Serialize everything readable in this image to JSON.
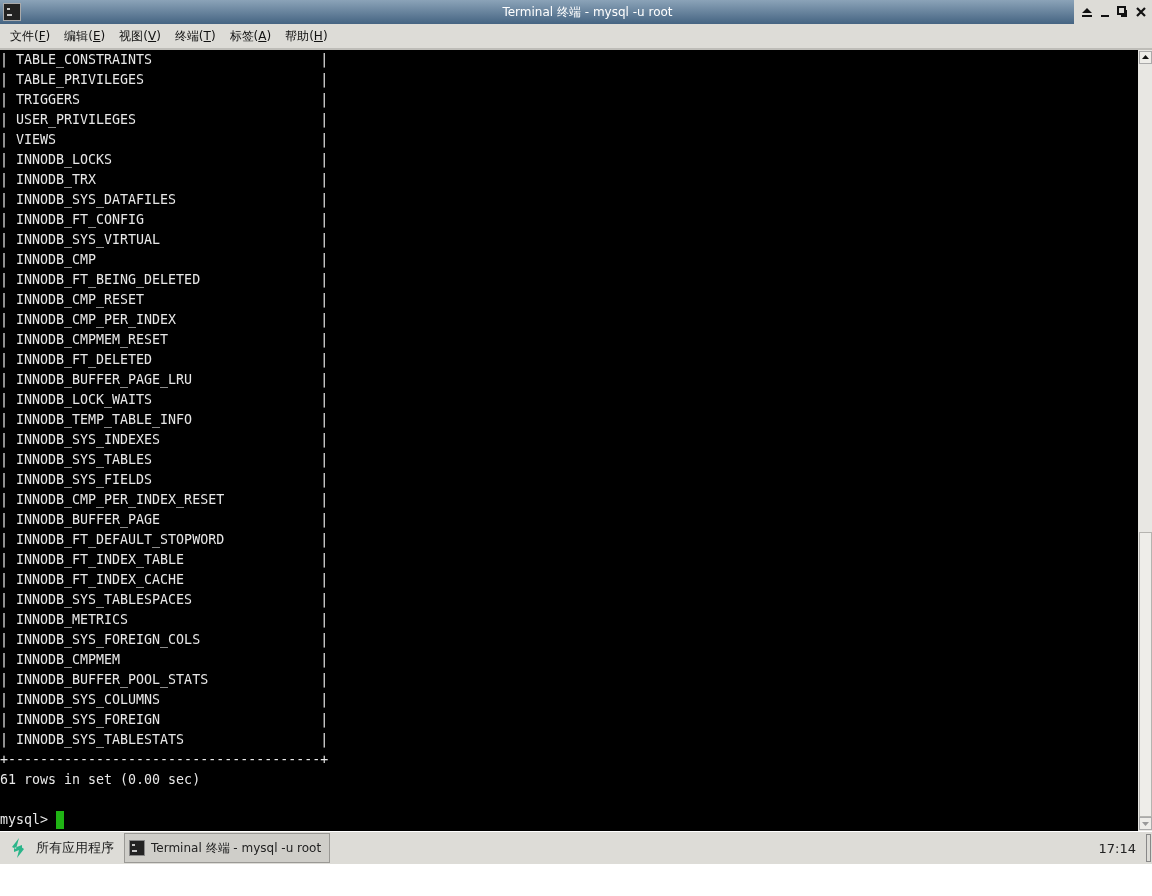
{
  "window": {
    "title": "Terminal 终端 - mysql -u root"
  },
  "menu": [
    "文件(F)",
    "编辑(E)",
    "视图(V)",
    "终端(T)",
    "标签(A)",
    "帮助(H)"
  ],
  "terminal": {
    "lines": [
      "| TABLE_CONSTRAINTS                     |",
      "| TABLE_PRIVILEGES                      |",
      "| TRIGGERS                              |",
      "| USER_PRIVILEGES                       |",
      "| VIEWS                                 |",
      "| INNODB_LOCKS                          |",
      "| INNODB_TRX                            |",
      "| INNODB_SYS_DATAFILES                  |",
      "| INNODB_FT_CONFIG                      |",
      "| INNODB_SYS_VIRTUAL                    |",
      "| INNODB_CMP                            |",
      "| INNODB_FT_BEING_DELETED               |",
      "| INNODB_CMP_RESET                      |",
      "| INNODB_CMP_PER_INDEX                  |",
      "| INNODB_CMPMEM_RESET                   |",
      "| INNODB_FT_DELETED                     |",
      "| INNODB_BUFFER_PAGE_LRU                |",
      "| INNODB_LOCK_WAITS                     |",
      "| INNODB_TEMP_TABLE_INFO                |",
      "| INNODB_SYS_INDEXES                    |",
      "| INNODB_SYS_TABLES                     |",
      "| INNODB_SYS_FIELDS                     |",
      "| INNODB_CMP_PER_INDEX_RESET            |",
      "| INNODB_BUFFER_PAGE                    |",
      "| INNODB_FT_DEFAULT_STOPWORD            |",
      "| INNODB_FT_INDEX_TABLE                 |",
      "| INNODB_FT_INDEX_CACHE                 |",
      "| INNODB_SYS_TABLESPACES                |",
      "| INNODB_METRICS                        |",
      "| INNODB_SYS_FOREIGN_COLS               |",
      "| INNODB_CMPMEM                         |",
      "| INNODB_BUFFER_POOL_STATS              |",
      "| INNODB_SYS_COLUMNS                    |",
      "| INNODB_SYS_FOREIGN                    |",
      "| INNODB_SYS_TABLESTATS                 |",
      "+---------------------------------------+",
      "61 rows in set (0.00 sec)"
    ],
    "prompt": "mysql>"
  },
  "taskbar": {
    "apps_menu": "所有应用程序",
    "tasks": [
      {
        "label": "Terminal 终端 - mysql -u root",
        "selected": true
      }
    ],
    "clock": "17:14"
  }
}
